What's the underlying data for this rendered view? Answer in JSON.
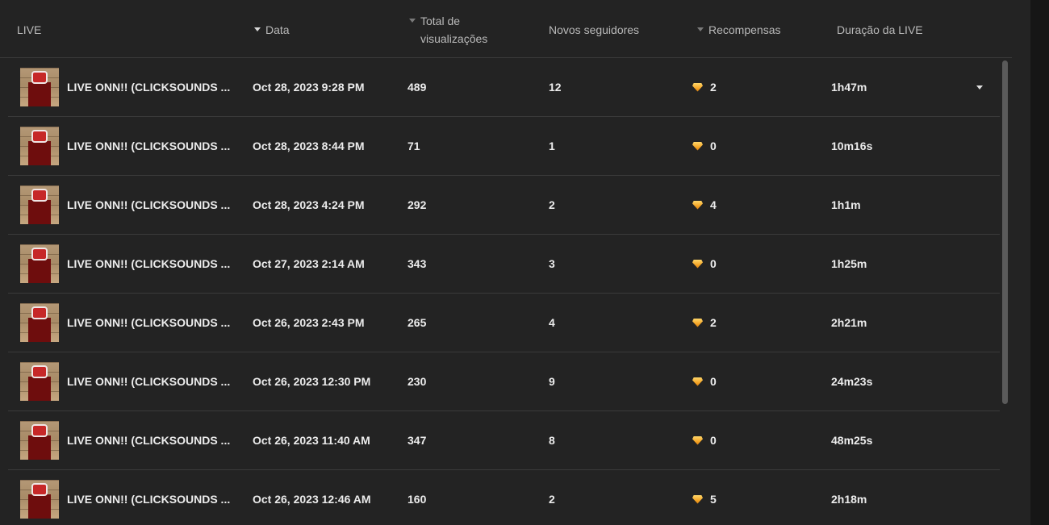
{
  "header": {
    "col_live": "LIVE",
    "col_date": "Data",
    "col_views_line1": "Total de",
    "col_views_line2": "visualizações",
    "col_followers": "Novos seguidores",
    "col_rewards": "Recompensas",
    "col_duration": "Duração da LIVE"
  },
  "icons": {
    "sort_date": "caret-down-icon",
    "sort_views": "caret-down-icon",
    "sort_rewards": "caret-down-icon",
    "reward": "gem-icon",
    "expand": "caret-down-icon"
  },
  "colors": {
    "background": "#232323",
    "gem": "#f4a324"
  },
  "rows": [
    {
      "title": "LIVE ONN!! (CLICKSOUNDS ...",
      "date": "Oct 28, 2023 9:28 PM",
      "views": "489",
      "followers": "12",
      "rewards": "2",
      "duration": "1h47m"
    },
    {
      "title": "LIVE ONN!! (CLICKSOUNDS ...",
      "date": "Oct 28, 2023 8:44 PM",
      "views": "71",
      "followers": "1",
      "rewards": "0",
      "duration": "10m16s"
    },
    {
      "title": "LIVE ONN!! (CLICKSOUNDS ...",
      "date": "Oct 28, 2023 4:24 PM",
      "views": "292",
      "followers": "2",
      "rewards": "4",
      "duration": "1h1m"
    },
    {
      "title": "LIVE ONN!! (CLICKSOUNDS ...",
      "date": "Oct 27, 2023 2:14 AM",
      "views": "343",
      "followers": "3",
      "rewards": "0",
      "duration": "1h25m"
    },
    {
      "title": "LIVE ONN!! (CLICKSOUNDS ...",
      "date": "Oct 26, 2023 2:43 PM",
      "views": "265",
      "followers": "4",
      "rewards": "2",
      "duration": "2h21m"
    },
    {
      "title": "LIVE ONN!! (CLICKSOUNDS ...",
      "date": "Oct 26, 2023 12:30 PM",
      "views": "230",
      "followers": "9",
      "rewards": "0",
      "duration": "24m23s"
    },
    {
      "title": "LIVE ONN!! (CLICKSOUNDS ...",
      "date": "Oct 26, 2023 11:40 AM",
      "views": "347",
      "followers": "8",
      "rewards": "0",
      "duration": "48m25s"
    },
    {
      "title": "LIVE ONN!! (CLICKSOUNDS ...",
      "date": "Oct 26, 2023 12:46 AM",
      "views": "160",
      "followers": "2",
      "rewards": "5",
      "duration": "2h18m"
    }
  ]
}
